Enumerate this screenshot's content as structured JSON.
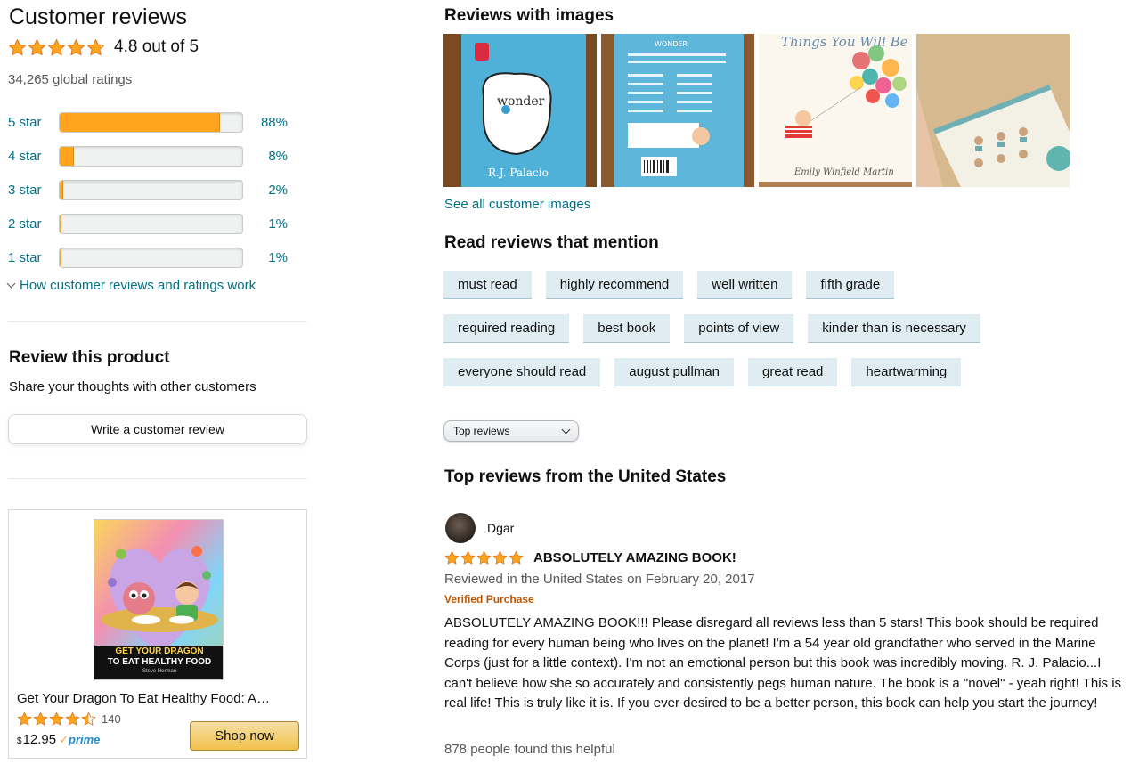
{
  "summary": {
    "title": "Customer reviews",
    "rating_stars": 4.8,
    "rating_text": "4.8 out of 5",
    "global_ratings": "34,265 global ratings",
    "histogram": [
      {
        "label": "5 star",
        "percent": 88,
        "percent_text": "88%"
      },
      {
        "label": "4 star",
        "percent": 8,
        "percent_text": "8%"
      },
      {
        "label": "3 star",
        "percent": 2,
        "percent_text": "2%"
      },
      {
        "label": "2 star",
        "percent": 1,
        "percent_text": "1%"
      },
      {
        "label": "1 star",
        "percent": 1,
        "percent_text": "1%"
      }
    ],
    "how_link": "How customer reviews and ratings work"
  },
  "review_product": {
    "title": "Review this product",
    "subtitle": "Share your thoughts with other customers",
    "button": "Write a customer review"
  },
  "ad": {
    "cover_line1": "GET YOUR DRAGON",
    "cover_line2": "TO EAT HEALTHY FOOD",
    "cover_author": "Steve Herman",
    "title": "Get Your Dragon To Eat Healthy Food: A…",
    "rating_stars": 4.5,
    "rating_count": "140",
    "price_symbol": "$",
    "price": "12.95",
    "prime_label": "prime",
    "button": "Shop now"
  },
  "images": {
    "title": "Reviews with images",
    "thumb_texts": [
      "wonder",
      "R.J. Palacio",
      "WONDER",
      "Things You Will Be",
      "Emily Winfield Martin"
    ],
    "see_all": "See all customer images"
  },
  "mentions": {
    "title": "Read reviews that mention",
    "rows": [
      [
        "must read",
        "highly recommend",
        "well written",
        "fifth grade"
      ],
      [
        "required reading",
        "best book",
        "points of view",
        "kinder than is necessary"
      ],
      [
        "everyone should read",
        "august pullman",
        "great read",
        "heartwarming"
      ]
    ]
  },
  "sort": {
    "selected": "Top reviews"
  },
  "top_reviews": {
    "title": "Top reviews from the United States",
    "review": {
      "author": "Dgar",
      "rating_stars": 5,
      "headline": "ABSOLUTELY AMAZING BOOK!",
      "date": "Reviewed in the United States on February 20, 2017",
      "verified": "Verified Purchase",
      "body": "ABSOLUTELY AMAZING BOOK!!! Please disregard all reviews less than 5 stars! This book should be required reading for every human being who lives on the planet! I'm a 54 year old grandfather who served in the Marine Corps (just for a little context). I'm not an emotional person but this book was incredibly moving. R. J. Palacio...I can't believe how she so accurately and consistently pegs human nature. The book is a \"novel\" - yeah right! This is real life! This is truly like it is. If you ever desired to be a better person, this book can help you start the journey!",
      "helpful": "878 people found this helpful"
    }
  },
  "colors": {
    "star": "#FFA41C",
    "link": "#007185",
    "chip_bg": "#DFECF1",
    "verified": "#C45500"
  }
}
